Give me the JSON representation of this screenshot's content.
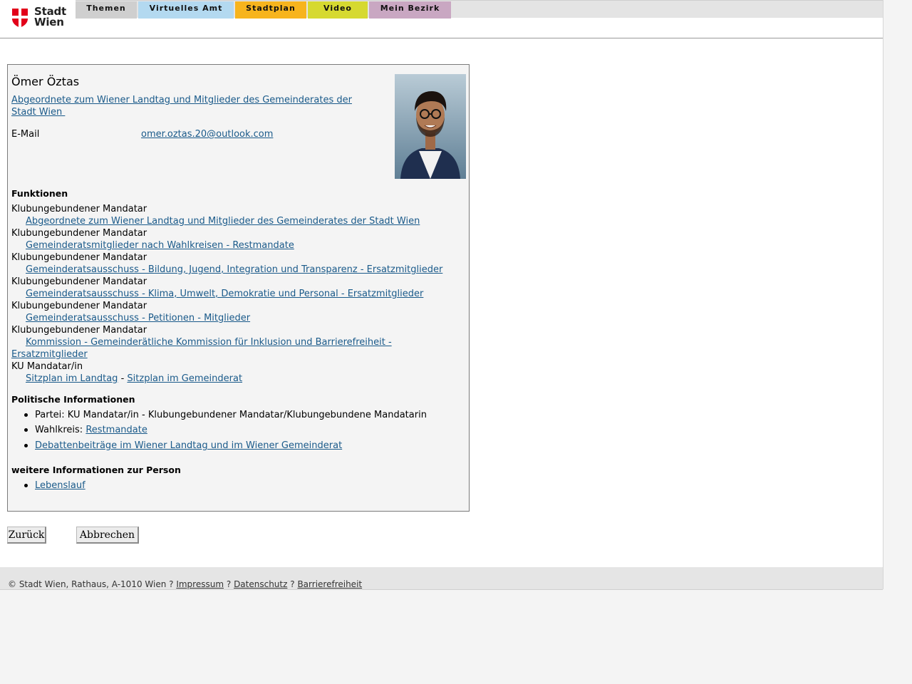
{
  "brand": {
    "logo_line1": "Stadt",
    "logo_line2": "Wien",
    "logo_red": "#e2001a"
  },
  "nav": {
    "tabs": [
      {
        "label": "Themen",
        "color": "#cfcfcf"
      },
      {
        "label": "Virtuelles Amt",
        "color": "#b3d9f0"
      },
      {
        "label": "Stadtplan",
        "color": "#f7b41d"
      },
      {
        "label": "Video",
        "color": "#d6d930"
      },
      {
        "label": "Mein Bezirk",
        "color": "#c9a7c2"
      }
    ]
  },
  "person": {
    "name": "Ömer Öztas",
    "group_link_line1": "Abgeordnete zum Wiener Landtag und Mitglieder des Gemeinderates der",
    "group_link_line2": "Stadt Wien ",
    "email_label": "E-Mail",
    "email": "omer.oztas.20@outlook.com",
    "photo_icon": "portrait-photo"
  },
  "functions": {
    "title": "Funktionen",
    "entries": [
      {
        "role": "Klubungebundener Mandatar",
        "link": "Abgeordnete zum Wiener Landtag und Mitglieder des Gemeinderates der Stadt Wien"
      },
      {
        "role": "Klubungebundener Mandatar",
        "link": "Gemeinderatsmitglieder nach Wahlkreisen - Restmandate"
      },
      {
        "role": "Klubungebundener Mandatar",
        "link": "Gemeinderatsausschuss - Bildung, Jugend, Integration und Transparenz - Ersatzmitglieder"
      },
      {
        "role": "Klubungebundener Mandatar",
        "link": "Gemeinderatsausschuss - Klima, Umwelt, Demokratie und Personal - Ersatzmitglieder"
      },
      {
        "role": "Klubungebundener Mandatar",
        "link": "Gemeinderatsausschuss - Petitionen - Mitglieder"
      },
      {
        "role": "Klubungebundener Mandatar",
        "link_line1": "Kommission - Gemeinderätliche Kommission für Inklusion und Barrierefreiheit -",
        "link_line2": "Ersatzmitglieder"
      }
    ],
    "party_role": "KU Mandatar/in",
    "seat_link_landtag": "Sitzplan im Landtag",
    "seat_separator": "-",
    "seat_link_gemeinderat": "Sitzplan im Gemeinderat"
  },
  "political": {
    "title": "Politische Informationen",
    "party_text": "Partei: KU Mandatar/in - Klubungebundener Mandatar/Klubungebundene Mandatarin",
    "district_label": "Wahlkreis:",
    "district_link": "Restmandate",
    "debates_link": "Debattenbeiträge im Wiener Landtag und im Wiener Gemeinderat"
  },
  "more_info": {
    "title": "weitere Informationen zur Person",
    "cv_link": "Lebenslauf"
  },
  "buttons": {
    "back": "Zurück",
    "cancel": "Abbrechen"
  },
  "footer": {
    "copyright": "© Stadt Wien, Rathaus, A-1010 Wien ?",
    "imprint": "Impressum",
    "sep1": "?",
    "privacy": "Datenschutz",
    "sep2": "?",
    "accessibility": "Barrierefreiheit"
  }
}
